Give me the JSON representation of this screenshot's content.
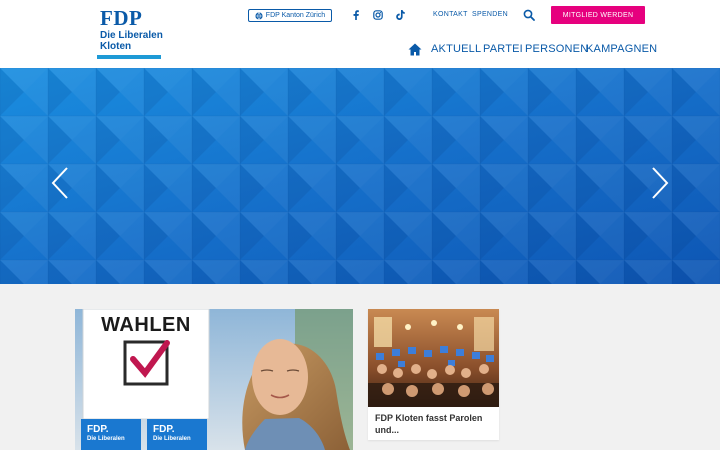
{
  "logo": {
    "wordmark": "FDP",
    "line1": "Die Liberalen",
    "line2": "Kloten"
  },
  "topbar": {
    "kanton_label": "FDP Kanton Zürich",
    "kontakt_label": "KONTAKT",
    "spenden_label": "SPENDEN",
    "cta_label": "MITGLIED WERDEN"
  },
  "social": [
    "facebook-icon",
    "instagram-icon",
    "tiktok-icon"
  ],
  "nav": {
    "items": [
      {
        "label": "AKTUELL"
      },
      {
        "label": "PARTEI"
      },
      {
        "label": "PERSONEN"
      },
      {
        "label": "KAMPAGNEN"
      }
    ]
  },
  "colors": {
    "brand": "#0a5aa8",
    "accent": "#e6007e",
    "hero": "#1a78d0",
    "light": "#1e9ad6"
  },
  "cards": {
    "main": {
      "sign_text": "WAHLEN",
      "badge_text": "FDP.",
      "badge_sub": "Die Liberalen"
    },
    "side": {
      "title": "FDP Kloten fasst Parolen und..."
    }
  }
}
